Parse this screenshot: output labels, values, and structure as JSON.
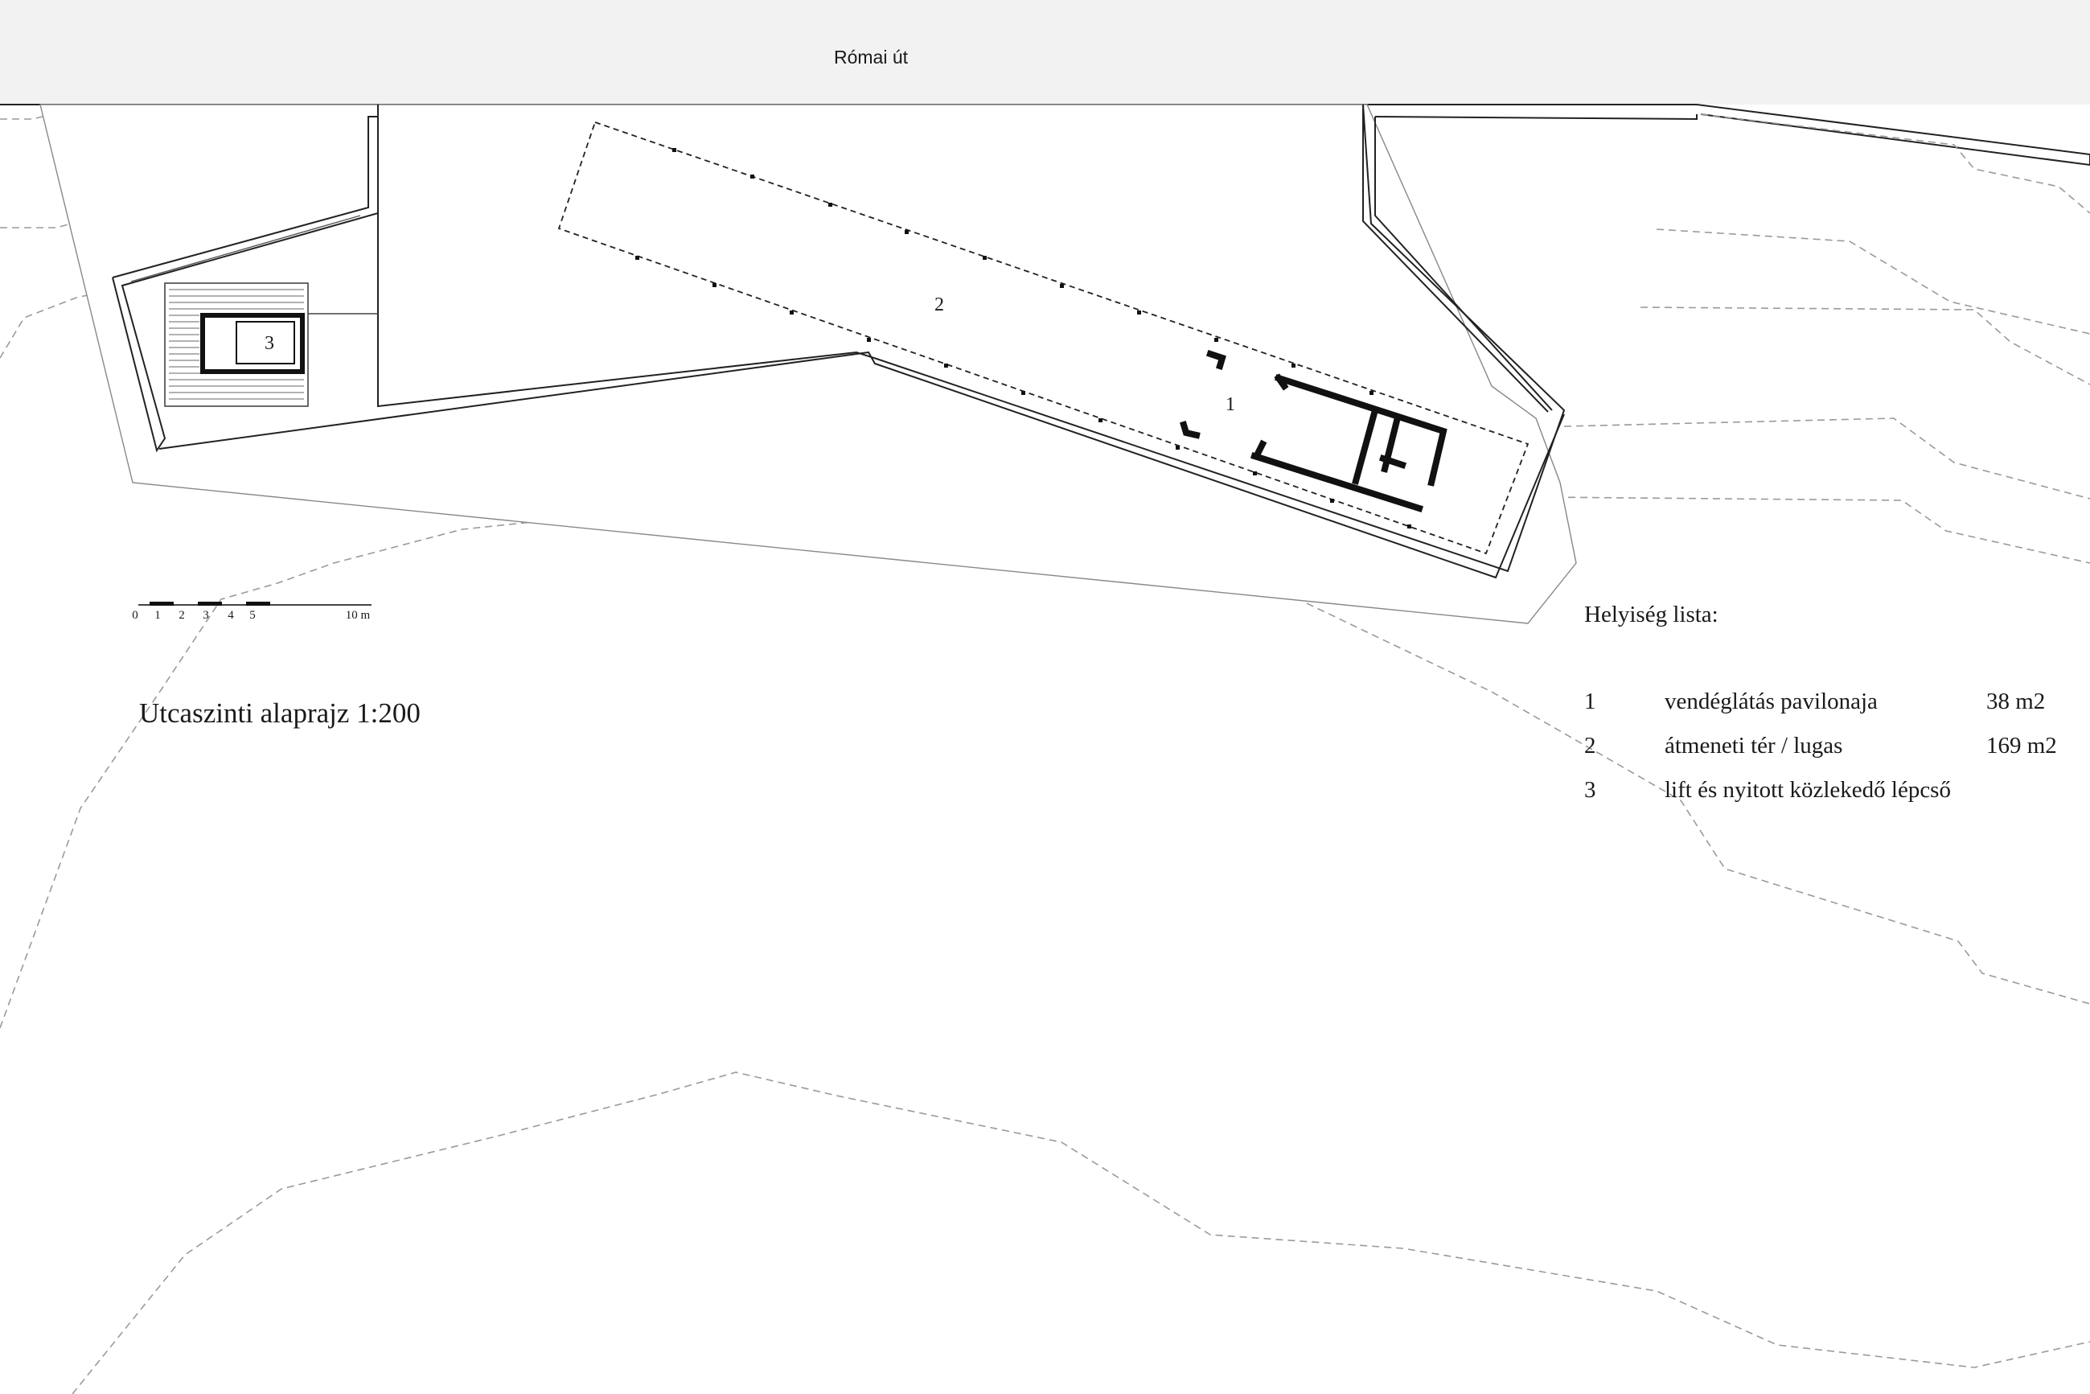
{
  "street": {
    "name": "Római út"
  },
  "rooms": {
    "room1": "1",
    "room2": "2",
    "room3": "3"
  },
  "drawing_title": "Utcaszinti alaprajz 1:200",
  "scale_bar": {
    "labels": [
      "0",
      "1",
      "2",
      "3",
      "4",
      "5"
    ],
    "end_label": "10 m"
  },
  "legend": {
    "title": "Helyiség lista:",
    "items": [
      {
        "number": "1",
        "name": "vendéglátás pavilonaja",
        "area": "38 m2"
      },
      {
        "number": "2",
        "name": "átmeneti tér / lugas",
        "area": "169 m2"
      },
      {
        "number": "3",
        "name": "lift és nyitott közlekedő lépcső",
        "area": ""
      }
    ]
  },
  "colors": {
    "street_fill": "#f2f2f2",
    "line": "#222222",
    "contour": "#9a9a9a"
  }
}
